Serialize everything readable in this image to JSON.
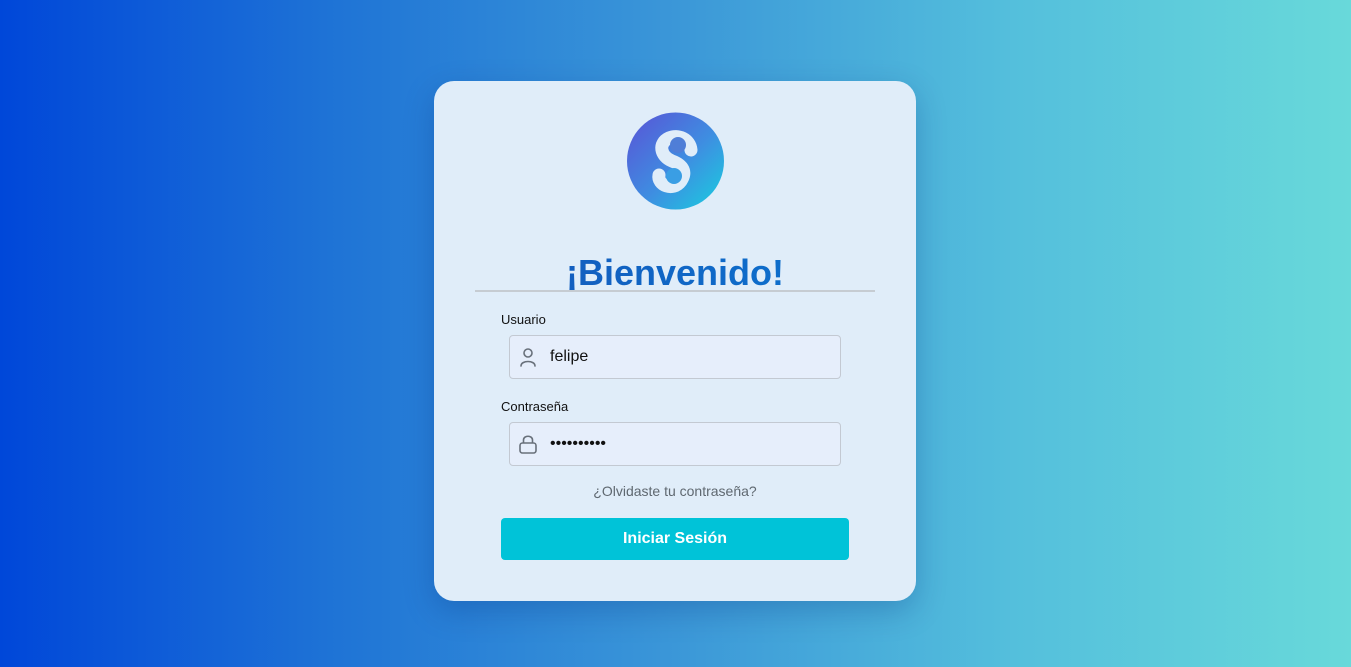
{
  "login": {
    "title": "¡Bienvenido!",
    "logo_icon": "s-logo-icon",
    "username": {
      "label": "Usuario",
      "value": "felipe",
      "icon": "user-icon"
    },
    "password": {
      "label": "Contraseña",
      "value": "••••••••••",
      "icon": "lock-icon"
    },
    "forgot_link": "¿Olvidaste tu contraseña?",
    "submit_label": "Iniciar Sesión"
  },
  "colors": {
    "background_start": "#0047d9",
    "background_end": "#68d9da",
    "card": "#e0edf9",
    "title": "#1656b8",
    "button": "#00c3d8",
    "button_text": "#ffffff",
    "link": "#5f6870"
  }
}
